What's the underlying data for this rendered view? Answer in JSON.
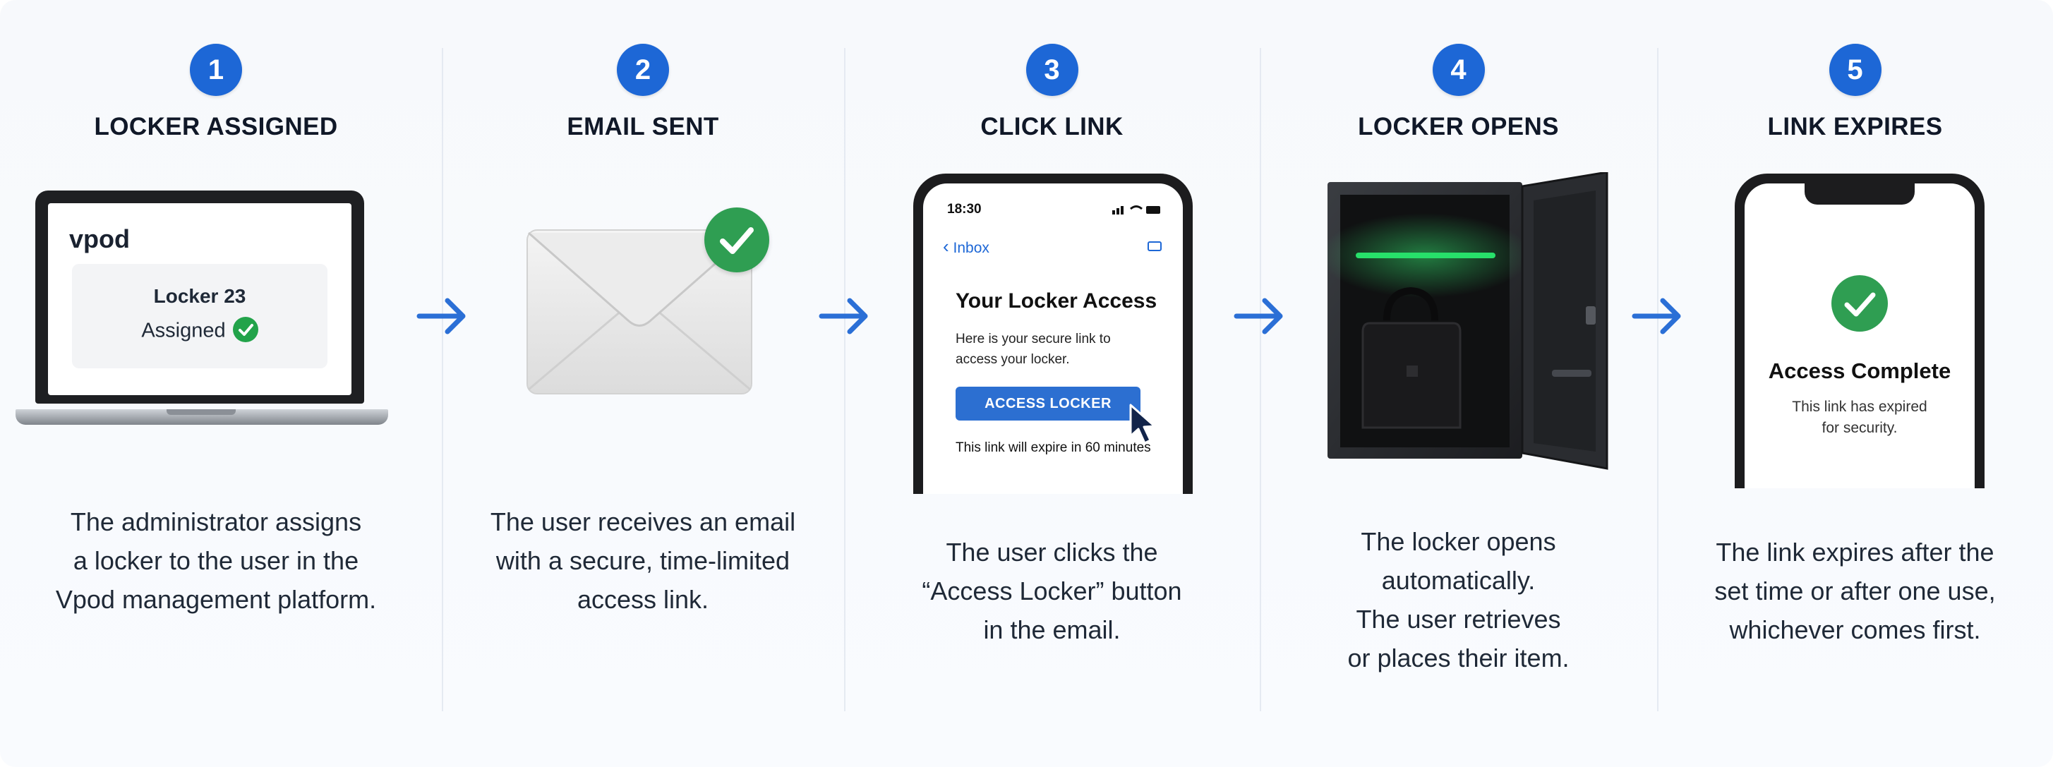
{
  "steps": [
    {
      "number": "1",
      "title": "LOCKER ASSIGNED",
      "description": "The administrator assigns\na locker to the user in the\nVpod management platform."
    },
    {
      "number": "2",
      "title": "EMAIL SENT",
      "description": "The user receives an email\nwith a secure, time-limited\naccess link."
    },
    {
      "number": "3",
      "title": "CLICK LINK",
      "description": "The user clicks the\n“Access Locker” button\nin the email."
    },
    {
      "number": "4",
      "title": "LOCKER OPENS",
      "description": "The locker opens\nautomatically.\nThe user retrieves\nor places their item."
    },
    {
      "number": "5",
      "title": "LINK EXPIRES",
      "description": "The link expires after the\nset time or after one use,\nwhichever comes first."
    }
  ],
  "laptop": {
    "logo": "vpod",
    "card_title": "Locker 23",
    "card_status": "Assigned"
  },
  "email_phone": {
    "time": "18:30",
    "back_label": "Inbox",
    "subject": "Your Locker Access",
    "body": "Here is your secure link to\naccess your locker.",
    "button_label": "ACCESS LOCKER",
    "footer": "This link will expire in 60 minutes"
  },
  "complete_phone": {
    "title": "Access Complete",
    "body": "This link has expired\nfor security."
  },
  "colors": {
    "accent": "#1d67d6",
    "success": "#2f9e52",
    "locker_light": "#27e06a"
  }
}
